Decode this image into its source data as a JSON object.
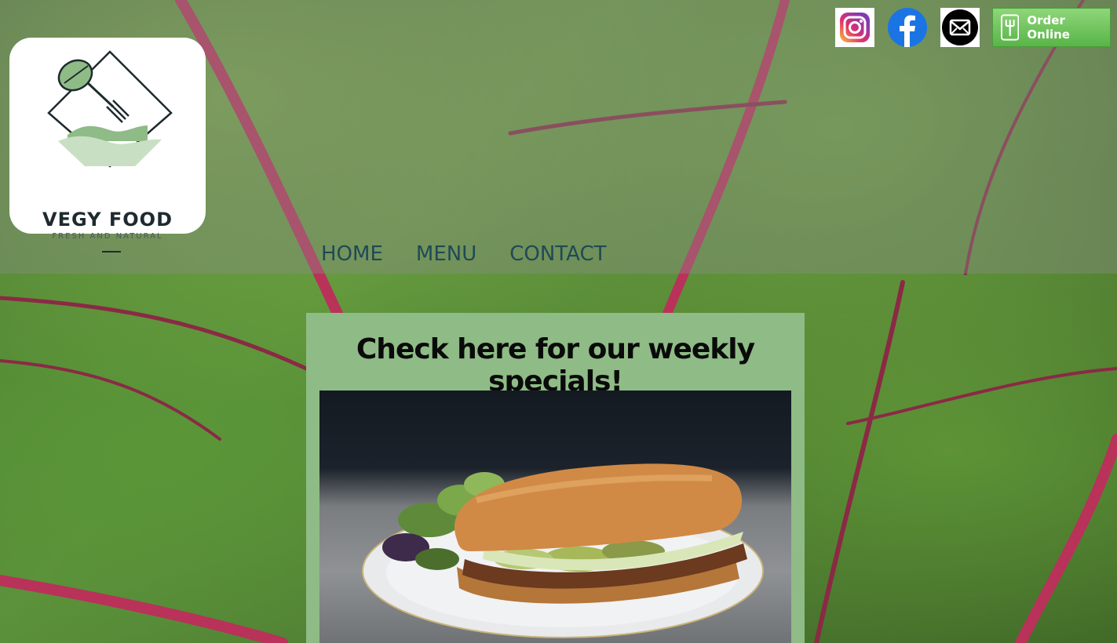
{
  "logo": {
    "title": "VEGY FOOD",
    "subtitle": "FRESH AND NATURAL",
    "icon": "leaf-fork-icon"
  },
  "nav": {
    "items": [
      {
        "label": "HOME"
      },
      {
        "label": "MENU"
      },
      {
        "label": "CONTACT"
      }
    ]
  },
  "social": {
    "instagram_icon": "instagram-icon",
    "facebook_icon": "facebook-icon",
    "email_icon": "email-icon"
  },
  "order": {
    "label": "Order Online",
    "icon": "fork-icon"
  },
  "specials": {
    "heading": "Check here for our weekly specials!",
    "image": "sandwich-photo"
  },
  "colors": {
    "nav_text": "#1f4a56",
    "specials_bg": "#8fbb86",
    "order_button": "#59b548"
  }
}
